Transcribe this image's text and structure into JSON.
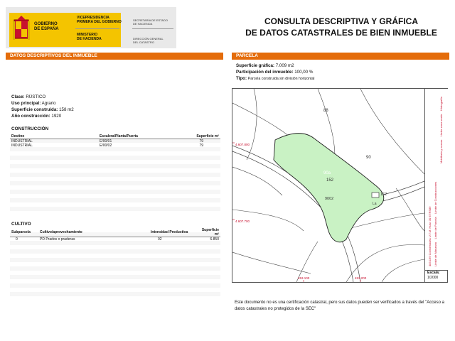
{
  "header": {
    "government": [
      "GOBIERNO",
      "DE ESPAÑA"
    ],
    "vicepresidencia": [
      "VICEPRESIDENCIA",
      "PRIMERA DEL GOBIERNO"
    ],
    "ministerio": [
      "MINISTERIO",
      "DE HACIENDA"
    ],
    "secretaria": [
      "SECRETARÍA DE ESTADO",
      "DE HACIENDA"
    ],
    "direccion": [
      "DIRECCIÓN GENERAL",
      "DEL CATASTRO"
    ],
    "title_lines": [
      "CONSULTA DESCRIPTIVA Y GRÁFICA",
      "DE DATOS CATASTRALES DE BIEN INMUEBLE"
    ]
  },
  "left": {
    "section_title": "DATOS DESCRIPTIVOS DEL INMUEBLE",
    "fields": [
      {
        "label": "Clase:",
        "value": "RÚSTICO"
      },
      {
        "label": "Uso principal:",
        "value": "Agrario"
      },
      {
        "label": "Superficie construida:",
        "value": "158 m2"
      },
      {
        "label": "Año construcción:",
        "value": "1920"
      }
    ],
    "construccion": {
      "heading": "CONSTRUCCIÓN",
      "columns": [
        "Destino",
        "Escalera/Planta/Puerta",
        "Superficie m²"
      ],
      "rows": [
        [
          "INDUSTRIAL",
          "E/00/01",
          "79"
        ],
        [
          "INDUSTRIAL",
          "E/00/02",
          "79"
        ]
      ]
    },
    "cultivo": {
      "heading": "CULTIVO",
      "columns": [
        "Subparcela",
        "Cultivo/aprovechamiento",
        "Intensidad Productiva",
        "Superficie m²"
      ],
      "rows": [
        [
          "0",
          "PD Prados o praderas",
          "02",
          "6.850"
        ]
      ]
    }
  },
  "right": {
    "section_title": "PARCELA",
    "fields": [
      {
        "label": "Superficie gráfica:",
        "value": "7.009 m2"
      },
      {
        "label": "Participación del inmueble:",
        "value": "100,00 %"
      },
      {
        "label": "Tipo:",
        "value": "Parcela construida sin división horizontal"
      }
    ],
    "map": {
      "labels": {
        "p88": "88",
        "p90": "90",
        "p90a": "90a",
        "p152": "152",
        "p162": "162",
        "p9002": "9002",
        "pLa": "La",
        "y1": "4.607.800",
        "y2": "4.607.700",
        "x1": "453.100",
        "x2": "453.200"
      },
      "legend": [
        "Límite de Manzana",
        "Límite de Parcela",
        "Límite de Construcciones",
        "Mobiliario y aceras",
        "Límite zona verde",
        "Hidrografía"
      ],
      "coords_note": "483.199 Coordenadas U.T.M. Huso 30 ETRS89",
      "scale_label": "Escala:",
      "scale_value": "1/2000",
      "colors": {
        "parcel_fill": "#c9f2c4",
        "parcel_stroke": "#222222",
        "legend_red": "#c8102e"
      }
    },
    "footer": "Este documento no es una certificación catastral, pero sus datos pueden ser verificados a través del \"Acceso a datos catastrales no protegidos de la SEC\""
  }
}
